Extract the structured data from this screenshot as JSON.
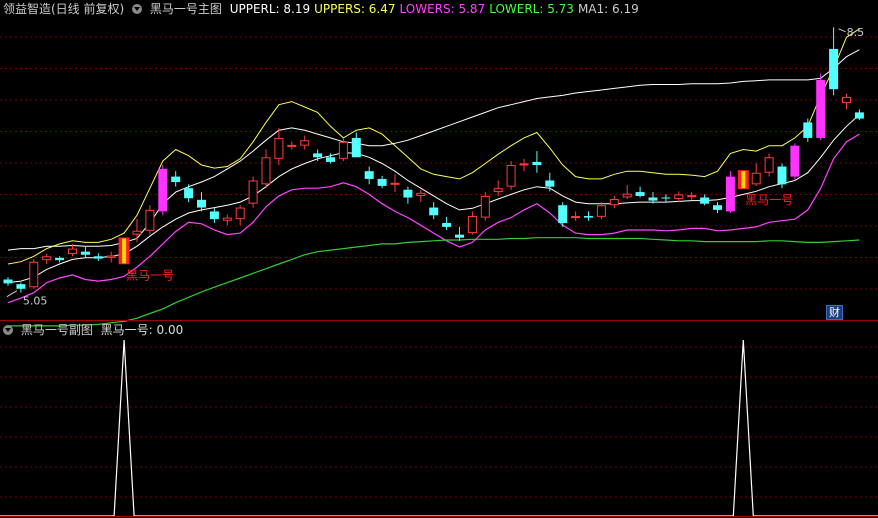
{
  "main_panel": {
    "title": "领益智造(日线 前复权)",
    "indicator_name": "黑马一号主图",
    "indicators": [
      {
        "label": "UPPERL: 8.19",
        "color": "#ffffff"
      },
      {
        "label": "UPPERS: 6.47",
        "color": "#ffff55"
      },
      {
        "label": "LOWERS: 5.87",
        "color": "#ff44ff"
      },
      {
        "label": "LOWERL: 5.73",
        "color": "#44ff44"
      },
      {
        "label": "MA1: 6.19",
        "color": "#cccccc"
      }
    ],
    "low_label": "5.05",
    "high_label": "8.5",
    "signal_label": "黑马一号",
    "badge": "财"
  },
  "sub_panel": {
    "indicator_name": "黑马一号副图",
    "value_label": "黑马一号: 0.00"
  },
  "colors": {
    "up": "#ff3c3c",
    "down": "#54ffff",
    "upper_long": "#ffffff",
    "upper_short": "#ffff55",
    "lower_short": "#ff44ff",
    "lower_long": "#33cc33",
    "ma": "#ffffff",
    "signal": "#ff2020",
    "grid": "#7a0000"
  },
  "chart_data": [
    {
      "type": "candlestick",
      "title": "领益智造(日线 前复权)",
      "ylim": [
        4.8,
        8.6
      ],
      "candles": [
        [
          5.22,
          5.25,
          5.14,
          5.17
        ],
        [
          5.16,
          5.18,
          5.05,
          5.1
        ],
        [
          5.12,
          5.48,
          5.1,
          5.45
        ],
        [
          5.47,
          5.55,
          5.42,
          5.52
        ],
        [
          5.5,
          5.52,
          5.44,
          5.47
        ],
        [
          5.55,
          5.68,
          5.52,
          5.62
        ],
        [
          5.58,
          5.64,
          5.5,
          5.54
        ],
        [
          5.52,
          5.56,
          5.46,
          5.49
        ],
        [
          5.5,
          5.58,
          5.44,
          5.53
        ],
        [
          5.45,
          5.75,
          5.43,
          5.72
        ],
        [
          5.8,
          6.0,
          5.7,
          5.85
        ],
        [
          5.85,
          6.18,
          5.8,
          6.12
        ],
        [
          6.1,
          6.7,
          6.05,
          6.65
        ],
        [
          6.55,
          6.62,
          6.42,
          6.48
        ],
        [
          6.4,
          6.45,
          6.22,
          6.27
        ],
        [
          6.25,
          6.35,
          6.1,
          6.15
        ],
        [
          6.1,
          6.15,
          5.95,
          6.0
        ],
        [
          5.98,
          6.06,
          5.92,
          6.02
        ],
        [
          6.0,
          6.18,
          5.92,
          6.15
        ],
        [
          6.2,
          6.55,
          6.15,
          6.5
        ],
        [
          6.45,
          6.9,
          6.4,
          6.8
        ],
        [
          6.78,
          7.18,
          6.7,
          7.05
        ],
        [
          6.95,
          7.0,
          6.9,
          6.96
        ],
        [
          6.95,
          7.08,
          6.9,
          7.02
        ],
        [
          6.85,
          6.9,
          6.75,
          6.8
        ],
        [
          6.8,
          6.85,
          6.72,
          6.74
        ],
        [
          6.78,
          7.05,
          6.75,
          7.0
        ],
        [
          7.05,
          7.12,
          6.95,
          6.8
        ],
        [
          6.62,
          6.68,
          6.45,
          6.52
        ],
        [
          6.52,
          6.56,
          6.4,
          6.43
        ],
        [
          6.45,
          6.58,
          6.35,
          6.47
        ],
        [
          6.38,
          6.42,
          6.2,
          6.28
        ],
        [
          6.3,
          6.38,
          6.22,
          6.34
        ],
        [
          6.15,
          6.22,
          6.0,
          6.05
        ],
        [
          5.95,
          6.03,
          5.86,
          5.9
        ],
        [
          5.8,
          5.9,
          5.72,
          5.76
        ],
        [
          5.82,
          6.1,
          5.8,
          6.04
        ],
        [
          6.02,
          6.35,
          5.98,
          6.3
        ],
        [
          6.35,
          6.5,
          6.3,
          6.4
        ],
        [
          6.42,
          6.75,
          6.38,
          6.7
        ],
        [
          6.7,
          6.78,
          6.62,
          6.72
        ],
        [
          6.74,
          6.88,
          6.6,
          6.7
        ],
        [
          6.5,
          6.6,
          6.36,
          6.42
        ],
        [
          6.18,
          6.22,
          5.9,
          5.95
        ],
        [
          6.02,
          6.1,
          5.98,
          6.04
        ],
        [
          6.04,
          6.1,
          5.98,
          6.02
        ],
        [
          6.03,
          6.22,
          6.0,
          6.18
        ],
        [
          6.18,
          6.3,
          6.14,
          6.26
        ],
        [
          6.28,
          6.44,
          6.26,
          6.33
        ],
        [
          6.35,
          6.42,
          6.28,
          6.3
        ],
        [
          6.28,
          6.35,
          6.2,
          6.24
        ],
        [
          6.28,
          6.32,
          6.22,
          6.27
        ],
        [
          6.26,
          6.36,
          6.22,
          6.32
        ],
        [
          6.3,
          6.35,
          6.25,
          6.31
        ],
        [
          6.28,
          6.32,
          6.18,
          6.2
        ],
        [
          6.18,
          6.22,
          6.08,
          6.12
        ],
        [
          6.1,
          6.62,
          6.08,
          6.55
        ],
        [
          6.55,
          6.62,
          6.4,
          6.5
        ],
        [
          6.45,
          6.72,
          6.43,
          6.6
        ],
        [
          6.6,
          6.85,
          6.55,
          6.8
        ],
        [
          6.68,
          6.72,
          6.4,
          6.45
        ],
        [
          6.55,
          6.98,
          6.5,
          6.95
        ],
        [
          7.25,
          7.3,
          7.0,
          7.05
        ],
        [
          7.05,
          7.88,
          7.02,
          7.8
        ],
        [
          8.2,
          8.48,
          7.6,
          7.68
        ],
        [
          7.5,
          7.62,
          7.42,
          7.58
        ],
        [
          7.38,
          7.42,
          7.28,
          7.3
        ]
      ],
      "signals": [
        9,
        57
      ],
      "series": [
        {
          "name": "UPPERL",
          "values": [
            5.6,
            5.62,
            5.62,
            5.65,
            5.65,
            5.66,
            5.65,
            5.65,
            5.66,
            5.7,
            5.75,
            5.95,
            6.2,
            6.35,
            6.42,
            6.48,
            6.55,
            6.65,
            6.75,
            6.88,
            7.02,
            7.15,
            7.18,
            7.15,
            7.1,
            7.05,
            7.0,
            6.98,
            6.95,
            6.95,
            6.98,
            7.02,
            7.08,
            7.14,
            7.2,
            7.26,
            7.32,
            7.38,
            7.44,
            7.48,
            7.52,
            7.56,
            7.58,
            7.6,
            7.63,
            7.65,
            7.67,
            7.69,
            7.71,
            7.73,
            7.74,
            7.74,
            7.74,
            7.75,
            7.75,
            7.75,
            7.76,
            7.78,
            7.79,
            7.8,
            7.8,
            7.8,
            7.8,
            7.82,
            7.95,
            8.1,
            8.19
          ]
        },
        {
          "name": "UPPERS",
          "values": [
            5.42,
            5.45,
            5.52,
            5.62,
            5.68,
            5.72,
            5.7,
            5.7,
            5.74,
            5.82,
            6.05,
            6.4,
            6.75,
            6.9,
            6.82,
            6.7,
            6.66,
            6.68,
            6.78,
            7.0,
            7.25,
            7.48,
            7.52,
            7.45,
            7.38,
            7.2,
            7.05,
            7.15,
            7.18,
            7.1,
            6.95,
            6.8,
            6.65,
            6.58,
            6.55,
            6.52,
            6.6,
            6.72,
            6.84,
            6.95,
            7.05,
            7.12,
            6.92,
            6.7,
            6.55,
            6.52,
            6.52,
            6.58,
            6.62,
            6.62,
            6.6,
            6.58,
            6.58,
            6.57,
            6.55,
            6.62,
            6.85,
            6.9,
            6.88,
            6.95,
            6.95,
            7.05,
            7.2,
            7.6,
            7.95,
            8.35,
            8.46
          ]
        },
        {
          "name": "LOWERS",
          "values": [
            4.92,
            4.98,
            5.05,
            5.18,
            5.24,
            5.28,
            5.22,
            5.2,
            5.22,
            5.26,
            5.38,
            5.52,
            5.68,
            5.84,
            5.96,
            5.94,
            5.86,
            5.8,
            5.82,
            5.96,
            6.16,
            6.3,
            6.38,
            6.4,
            6.4,
            6.42,
            6.47,
            6.42,
            6.32,
            6.2,
            6.1,
            6.02,
            5.92,
            5.82,
            5.72,
            5.64,
            5.7,
            5.86,
            5.96,
            6.02,
            6.12,
            6.2,
            6.08,
            5.92,
            5.82,
            5.8,
            5.8,
            5.82,
            5.86,
            5.86,
            5.86,
            5.85,
            5.86,
            5.88,
            5.88,
            5.85,
            5.86,
            5.88,
            5.9,
            5.96,
            5.98,
            6.0,
            6.12,
            6.4,
            6.78,
            7.0,
            7.1
          ]
        },
        {
          "name": "LOWERL",
          "values": [
            4.62,
            4.62,
            4.62,
            4.62,
            4.62,
            4.63,
            4.63,
            4.64,
            4.66,
            4.68,
            4.72,
            4.78,
            4.84,
            4.92,
            4.99,
            5.06,
            5.12,
            5.18,
            5.24,
            5.3,
            5.36,
            5.42,
            5.48,
            5.54,
            5.58,
            5.6,
            5.62,
            5.64,
            5.66,
            5.68,
            5.68,
            5.7,
            5.71,
            5.72,
            5.73,
            5.73,
            5.74,
            5.74,
            5.74,
            5.75,
            5.75,
            5.76,
            5.76,
            5.76,
            5.76,
            5.75,
            5.75,
            5.75,
            5.75,
            5.75,
            5.74,
            5.73,
            5.72,
            5.72,
            5.71,
            5.71,
            5.71,
            5.71,
            5.71,
            5.72,
            5.72,
            5.71,
            5.7,
            5.7,
            5.71,
            5.72,
            5.73
          ]
        },
        {
          "name": "MA1",
          "values": [
            5.18,
            5.2,
            5.25,
            5.35,
            5.42,
            5.48,
            5.5,
            5.5,
            5.52,
            5.55,
            5.65,
            5.78,
            5.9,
            6.0,
            6.08,
            6.12,
            6.15,
            6.18,
            6.22,
            6.3,
            6.42,
            6.55,
            6.65,
            6.72,
            6.78,
            6.82,
            6.86,
            6.85,
            6.8,
            6.72,
            6.62,
            6.5,
            6.4,
            6.3,
            6.2,
            6.12,
            6.14,
            6.2,
            6.26,
            6.32,
            6.38,
            6.42,
            6.4,
            6.3,
            6.22,
            6.2,
            6.2,
            6.2,
            6.21,
            6.22,
            6.22,
            6.22,
            6.23,
            6.24,
            6.24,
            6.25,
            6.28,
            6.32,
            6.36,
            6.42,
            6.46,
            6.5,
            6.6,
            6.8,
            7.02,
            7.2,
            7.35
          ]
        }
      ]
    },
    {
      "type": "line",
      "title": "黑马一号副图",
      "ylim": [
        0,
        1
      ],
      "series": [
        {
          "name": "黑马一号",
          "values": [
            0,
            0,
            0,
            0,
            0,
            0,
            0,
            0,
            0,
            1,
            0,
            0,
            0,
            0,
            0,
            0,
            0,
            0,
            0,
            0,
            0,
            0,
            0,
            0,
            0,
            0,
            0,
            0,
            0,
            0,
            0,
            0,
            0,
            0,
            0,
            0,
            0,
            0,
            0,
            0,
            0,
            0,
            0,
            0,
            0,
            0,
            0,
            0,
            0,
            0,
            0,
            0,
            0,
            0,
            0,
            0,
            0,
            1,
            0,
            0,
            0,
            0,
            0,
            0,
            0,
            0,
            0
          ]
        }
      ]
    }
  ]
}
